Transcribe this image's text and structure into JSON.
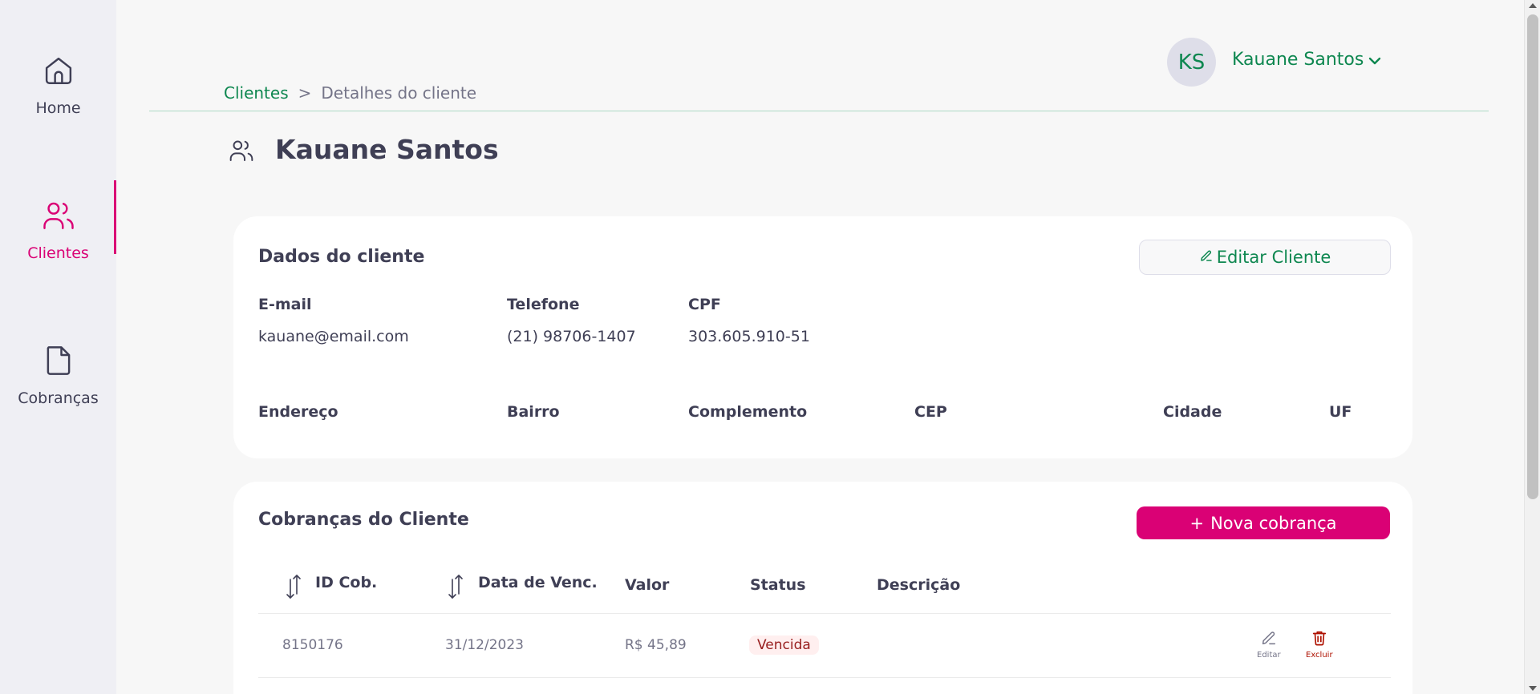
{
  "sidebar": {
    "items": [
      {
        "label": "Home",
        "icon": "home-icon",
        "active": false
      },
      {
        "label": "Clientes",
        "icon": "users-icon",
        "active": true
      },
      {
        "label": "Cobranças",
        "icon": "document-icon",
        "active": false
      }
    ]
  },
  "header": {
    "user": {
      "initials": "KS",
      "name": "Kauane Santos"
    },
    "breadcrumb": {
      "link": "Clientes",
      "separator": ">",
      "current": "Detalhes do cliente"
    }
  },
  "page": {
    "title": "Kauane Santos",
    "icon": "users-icon"
  },
  "client_card": {
    "title": "Dados do cliente",
    "edit_button": "Editar Cliente",
    "fields": {
      "email": {
        "label": "E-mail",
        "value": "kauane@email.com"
      },
      "phone": {
        "label": "Telefone",
        "value": "(21) 98706-1407"
      },
      "cpf": {
        "label": "CPF",
        "value": "303.605.910-51"
      },
      "address": {
        "label": "Endereço",
        "value": ""
      },
      "district": {
        "label": "Bairro",
        "value": ""
      },
      "complement": {
        "label": "Complemento",
        "value": ""
      },
      "cep": {
        "label": "CEP",
        "value": ""
      },
      "city": {
        "label": "Cidade",
        "value": ""
      },
      "uf": {
        "label": "UF",
        "value": ""
      }
    }
  },
  "charges_card": {
    "title": "Cobranças do Cliente",
    "new_button": "Nova cobrança",
    "new_button_prefix": "+",
    "columns": [
      "ID Cob.",
      "Data de Venc.",
      "Valor",
      "Status",
      "Descrição"
    ],
    "rows": [
      {
        "id": "8150176",
        "due_date": "31/12/2023",
        "value": "R$ 45,89",
        "status": "Vencida",
        "description": "",
        "edit_label": "Editar",
        "delete_label": "Excluir"
      }
    ]
  },
  "colors": {
    "accent": "#da0175",
    "brand_green": "#0e8750",
    "text": "#3f3f55",
    "muted": "#747488",
    "overdue_bg": "#ffefef",
    "overdue_text": "#971d1d"
  }
}
